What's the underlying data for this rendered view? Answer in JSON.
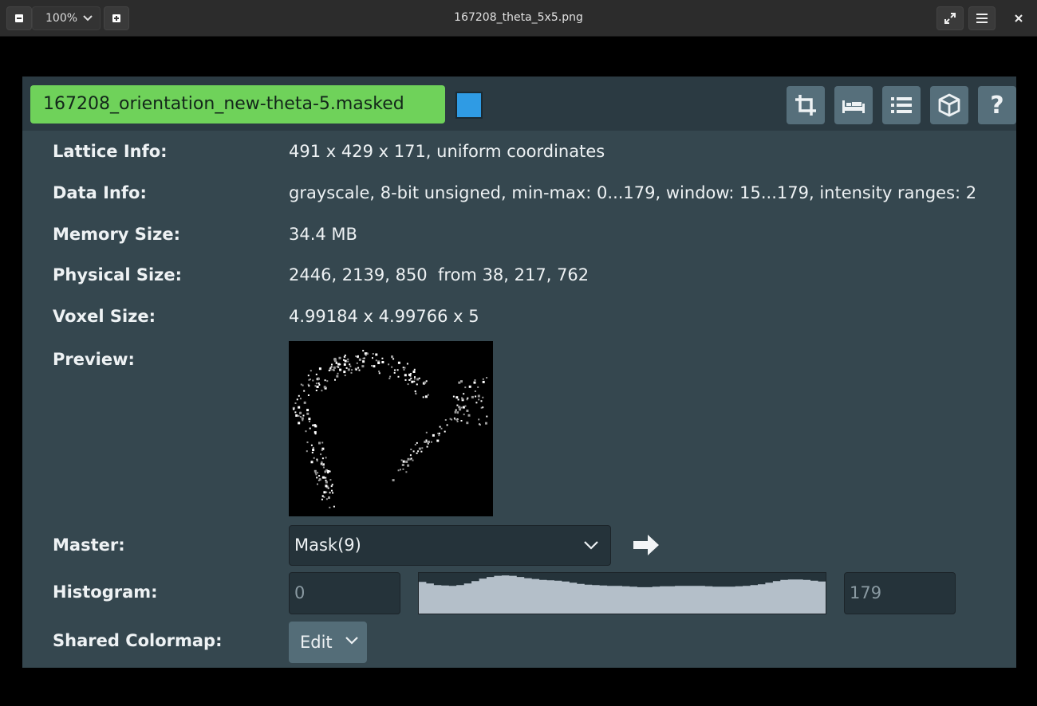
{
  "viewer": {
    "zoom": "100%",
    "file_title": "167208_theta_5x5.png"
  },
  "panel": {
    "name": "167208_orientation_new-theta-5.masked",
    "swatch_color": "#2f9be4",
    "header_icons": [
      "crop-icon",
      "bed-icon",
      "list-icon",
      "cube-icon",
      "help-icon"
    ],
    "help_glyph": "?"
  },
  "info": {
    "lattice_label": "Lattice Info:",
    "lattice_value": "491 x 429 x 171, uniform coordinates",
    "data_label": "Data Info:",
    "data_value": "grayscale, 8-bit unsigned, min-max: 0...179, window: 15...179, intensity ranges: 2",
    "memory_label": "Memory Size:",
    "memory_value": "34.4 MB",
    "physical_label": "Physical Size:",
    "physical_value": "2446, 2139, 850  from 38, 217, 762",
    "voxel_label": "Voxel Size:",
    "voxel_value": "4.99184 x 4.99766 x 5",
    "preview_label": "Preview:"
  },
  "master": {
    "label": "Master:",
    "selected": "Mask(9)"
  },
  "histogram": {
    "label": "Histogram:",
    "min": "0",
    "max": "179",
    "profile": [
      0.78,
      0.74,
      0.7,
      0.69,
      0.68,
      0.7,
      0.74,
      0.8,
      0.86,
      0.9,
      0.93,
      0.94,
      0.93,
      0.9,
      0.87,
      0.85,
      0.83,
      0.82,
      0.81,
      0.79,
      0.76,
      0.73,
      0.71,
      0.7,
      0.69,
      0.68,
      0.68,
      0.67,
      0.66,
      0.65,
      0.65,
      0.66,
      0.67,
      0.67,
      0.68,
      0.68,
      0.68,
      0.68,
      0.67,
      0.66,
      0.66,
      0.66,
      0.67,
      0.68,
      0.7,
      0.72,
      0.76,
      0.8,
      0.83,
      0.84,
      0.84,
      0.83,
      0.81,
      0.79
    ]
  },
  "colormap": {
    "label": "Shared Colormap:",
    "button": "Edit"
  }
}
